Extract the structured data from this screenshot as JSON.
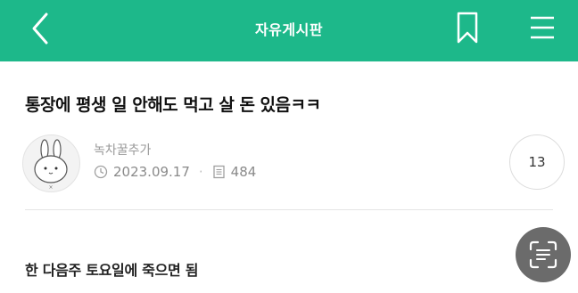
{
  "header": {
    "title": "자유게시판",
    "bg_color": "#1db88a",
    "back_icon": "chevron-left-icon",
    "bookmark_icon": "bookmark-icon",
    "menu_icon": "hamburger-menu-icon"
  },
  "post": {
    "title": "통장에 평생 일 안해도 먹고 살 돈 있음ㅋㅋ",
    "author": "녹차꿀추가",
    "date": "2023.09.17",
    "views": "484",
    "comment_count": "13",
    "body": "한 다음주 토요일에 죽으면 됨"
  },
  "floating": {
    "scan_icon": "text-scan-icon"
  }
}
